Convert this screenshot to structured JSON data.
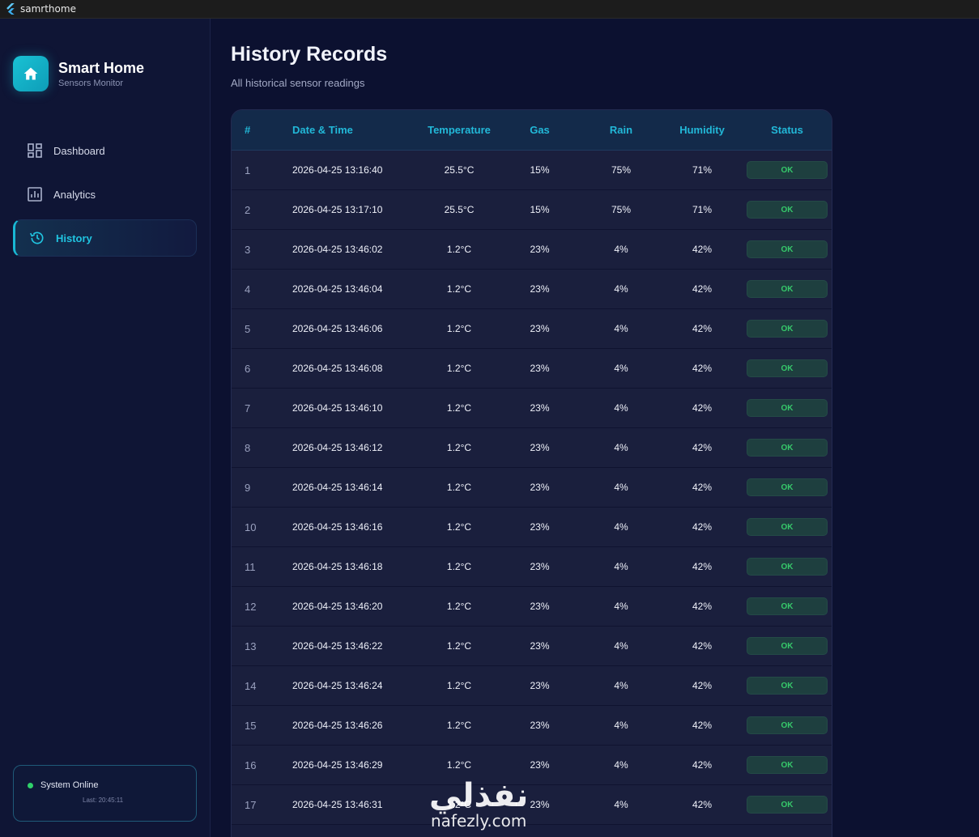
{
  "window": {
    "title": "samrthome"
  },
  "brand": {
    "title": "Smart Home",
    "subtitle": "Sensors Monitor"
  },
  "sidebar": {
    "items": [
      {
        "label": "Dashboard",
        "icon": "dashboard-icon",
        "active": false
      },
      {
        "label": "Analytics",
        "icon": "analytics-icon",
        "active": false
      },
      {
        "label": "History",
        "icon": "history-icon",
        "active": true
      }
    ],
    "status": {
      "text": "System Online",
      "last": "Last: 20:45:11",
      "color": "#2fd06a"
    }
  },
  "page": {
    "title": "History Records",
    "subtitle": "All historical sensor readings"
  },
  "table": {
    "headers": [
      "#",
      "Date & Time",
      "Temperature",
      "Gas",
      "Rain",
      "Humidity",
      "Status"
    ],
    "rows": [
      {
        "idx": "1",
        "date": "2026-04-25 13:16:40",
        "temp": "25.5°C",
        "gas": "15%",
        "rain": "75%",
        "hum": "71%",
        "status": "OK"
      },
      {
        "idx": "2",
        "date": "2026-04-25 13:17:10",
        "temp": "25.5°C",
        "gas": "15%",
        "rain": "75%",
        "hum": "71%",
        "status": "OK"
      },
      {
        "idx": "3",
        "date": "2026-04-25 13:46:02",
        "temp": "1.2°C",
        "gas": "23%",
        "rain": "4%",
        "hum": "42%",
        "status": "OK"
      },
      {
        "idx": "4",
        "date": "2026-04-25 13:46:04",
        "temp": "1.2°C",
        "gas": "23%",
        "rain": "4%",
        "hum": "42%",
        "status": "OK"
      },
      {
        "idx": "5",
        "date": "2026-04-25 13:46:06",
        "temp": "1.2°C",
        "gas": "23%",
        "rain": "4%",
        "hum": "42%",
        "status": "OK"
      },
      {
        "idx": "6",
        "date": "2026-04-25 13:46:08",
        "temp": "1.2°C",
        "gas": "23%",
        "rain": "4%",
        "hum": "42%",
        "status": "OK"
      },
      {
        "idx": "7",
        "date": "2026-04-25 13:46:10",
        "temp": "1.2°C",
        "gas": "23%",
        "rain": "4%",
        "hum": "42%",
        "status": "OK"
      },
      {
        "idx": "8",
        "date": "2026-04-25 13:46:12",
        "temp": "1.2°C",
        "gas": "23%",
        "rain": "4%",
        "hum": "42%",
        "status": "OK"
      },
      {
        "idx": "9",
        "date": "2026-04-25 13:46:14",
        "temp": "1.2°C",
        "gas": "23%",
        "rain": "4%",
        "hum": "42%",
        "status": "OK"
      },
      {
        "idx": "10",
        "date": "2026-04-25 13:46:16",
        "temp": "1.2°C",
        "gas": "23%",
        "rain": "4%",
        "hum": "42%",
        "status": "OK"
      },
      {
        "idx": "11",
        "date": "2026-04-25 13:46:18",
        "temp": "1.2°C",
        "gas": "23%",
        "rain": "4%",
        "hum": "42%",
        "status": "OK"
      },
      {
        "idx": "12",
        "date": "2026-04-25 13:46:20",
        "temp": "1.2°C",
        "gas": "23%",
        "rain": "4%",
        "hum": "42%",
        "status": "OK"
      },
      {
        "idx": "13",
        "date": "2026-04-25 13:46:22",
        "temp": "1.2°C",
        "gas": "23%",
        "rain": "4%",
        "hum": "42%",
        "status": "OK"
      },
      {
        "idx": "14",
        "date": "2026-04-25 13:46:24",
        "temp": "1.2°C",
        "gas": "23%",
        "rain": "4%",
        "hum": "42%",
        "status": "OK"
      },
      {
        "idx": "15",
        "date": "2026-04-25 13:46:26",
        "temp": "1.2°C",
        "gas": "23%",
        "rain": "4%",
        "hum": "42%",
        "status": "OK"
      },
      {
        "idx": "16",
        "date": "2026-04-25 13:46:29",
        "temp": "1.2°C",
        "gas": "23%",
        "rain": "4%",
        "hum": "42%",
        "status": "OK"
      },
      {
        "idx": "17",
        "date": "2026-04-25 13:46:31",
        "temp": "1.2°C",
        "gas": "23%",
        "rain": "4%",
        "hum": "42%",
        "status": "OK"
      }
    ]
  },
  "watermark": {
    "logo": "نفذلي",
    "url": "nafezly.com"
  },
  "colors": {
    "accent": "#22b8d8",
    "ok": "#36c86a",
    "background": "#0c1130"
  }
}
